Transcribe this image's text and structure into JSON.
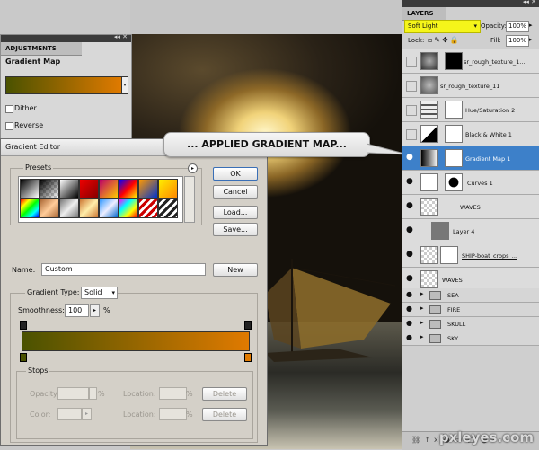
{
  "adjustments": {
    "tab": "ADJUSTMENTS",
    "title": "Gradient Map",
    "dither": "Dither",
    "reverse": "Reverse"
  },
  "gradient_editor": {
    "title": "Gradient Editor",
    "presets_label": "Presets",
    "ok": "OK",
    "cancel": "Cancel",
    "load": "Load...",
    "save": "Save...",
    "name_label": "Name:",
    "name_value": "Custom",
    "new": "New",
    "gradient_type_label": "Gradient Type:",
    "gradient_type_value": "Solid",
    "smoothness_label": "Smoothness:",
    "smoothness_value": "100",
    "smoothness_unit": "%",
    "stops_label": "Stops",
    "opacity_label": "Opacity:",
    "location_label": "Location:",
    "color_label": "Color:",
    "percent": "%",
    "delete": "Delete",
    "gradient_start_color": "#4a5200",
    "gradient_end_color": "#e07a00"
  },
  "callout": {
    "text": "... APPLIED GRADIENT MAP..."
  },
  "layers": {
    "tab": "LAYERS",
    "blend_mode": "Soft Light",
    "opacity_label": "Opacity:",
    "opacity_value": "100%",
    "lock_label": "Lock:",
    "fill_label": "Fill:",
    "fill_value": "100%",
    "items": [
      {
        "name": "sr_rough_texture_1...",
        "visible": false
      },
      {
        "name": "sr_rough_texture_11",
        "visible": false
      },
      {
        "name": "Hue/Saturation 2",
        "visible": false
      },
      {
        "name": "Black & White 1",
        "visible": false
      },
      {
        "name": "Gradient Map 1",
        "visible": true,
        "selected": true
      },
      {
        "name": "Curves 1",
        "visible": true
      },
      {
        "name": "WAVES",
        "visible": true
      },
      {
        "name": "Layer 4",
        "visible": true
      },
      {
        "name": "SHIP-boat_crops_...",
        "visible": true
      },
      {
        "name": "WAVES",
        "visible": true
      }
    ],
    "groups": [
      "SEA",
      "FIRE",
      "SKULL",
      "SKY"
    ]
  },
  "watermark": "pxleyes.com"
}
